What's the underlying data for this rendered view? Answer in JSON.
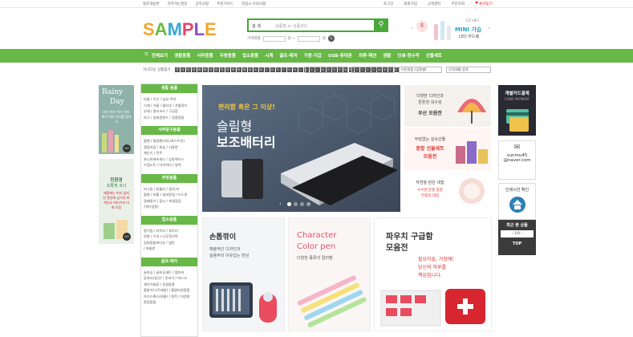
{
  "topbar": {
    "left": [
      "질문과답변",
      "자주하는질문",
      "공지사항",
      "주문가이드",
      "작업시 유의사항"
    ],
    "right": [
      "로그인",
      "회원가입",
      "고객센터",
      "주문조회",
      "즐겨찾기"
    ]
  },
  "logo": {
    "letters": [
      "S",
      "A",
      "M",
      "P",
      "L",
      "E"
    ],
    "colors": [
      "#f2a62c",
      "#6cba3f",
      "#3aa8d8",
      "#e8456b",
      "#8a4fc0",
      "#f2a62c"
    ]
  },
  "search": {
    "category": "검 색",
    "placeholder": "상품명 or 상품코드"
  },
  "price_search": {
    "label": "가격대별",
    "sep1": "원 ~",
    "sep2": "원",
    "go": "G"
  },
  "mini_banner": {
    "line1": "EZ-HIFI",
    "line2": "MINI 가습",
    "line3": "LED 무드램",
    "thumb": "추"
  },
  "nav": {
    "menu_icon": "hamburger-icon",
    "items": [
      "전체보기",
      "생활용품",
      "사무용품",
      "주방용품",
      "업소용품",
      "시계",
      "골프·레저",
      "가방·지갑",
      "USB·휴대폰",
      "의류·패션",
      "생활",
      "인쇄·현수막",
      "선물세트"
    ]
  },
  "alpha_search": {
    "label": "가나다순 상품찾기",
    "keys": [
      "가",
      "나",
      "다",
      "라",
      "마",
      "바",
      "사",
      "아",
      "자",
      "차",
      "카",
      "타",
      "파",
      "하",
      "A",
      "B",
      "C",
      "D",
      "E",
      "F",
      "G",
      "H",
      "I",
      "J",
      "K",
      "L",
      "M",
      "N",
      "O",
      "P",
      "Q",
      "R",
      "S",
      "T",
      "U",
      "V",
      "W",
      "X",
      "Y",
      "Z"
    ]
  },
  "selects": [
    "어린별로 (빨사행)",
    "(자) 분개 (대상별)",
    "어린얼품 (업종별)",
    "가격대별 검색"
  ],
  "left_banners": {
    "rainy_title_1": "Rainy",
    "rainy_title_2": "Day",
    "rainy_text": "여기 여기 미리 준비 해서 여러 미리를 맞아서",
    "go": "GO",
    "eco_title": "친환경",
    "eco_sub": "초록개 코너",
    "eco_text": "제품에는 미리 없지만 환경에 남기지 퍼 계신요 여러가지 미화 모음"
  },
  "categories": [
    {
      "title": "생활 용품",
      "items": [
        "타올 / 우산 / 담요·쿠션",
        "시계 / 거울 / 물티슈 / 손톱깎이",
        "부채 / 멀티코드 / 구급함",
        "머그 / 일회용밴드 / 정품용품"
      ]
    },
    {
      "title": "사무문구용품",
      "items": [
        "볼펜 / 형광펜(지도/포스트잇)",
        "명함지갑 / 회일 / 사용한",
        "계산기 / 전주",
        "포니미에프세드 / 상장케이스",
        "수첩노트 / 다이어리 / 달력"
      ]
    },
    {
      "title": "주방용품",
      "items": [
        "머그컵 / 텀블러 / 컵/도자",
        "물병 / 보틀 / 냄비받침 / 티스푼",
        "밀폐용기 / 접시 / 위생장갑",
        "기타(일용)"
      ]
    },
    {
      "title": "업소용품",
      "items": [
        "종이컵 / 라이터 / 포트리",
        "연봉 / 우지 / 나무젓가락",
        "일회용물퍼티슈 / 냅킨",
        "/ 머슬판"
      ]
    },
    {
      "title": "골프·레저",
      "items": [
        "골프공 / 골프공세트 / 볼마커",
        "등자티(등산) / 민보기 / 마스크",
        "체가거재료 / 등원용품",
        "출발기(스트레칭) / 출발타원용품",
        "아이스팩스(여름) / 원학 / 차량용",
        "창립용품"
      ]
    }
  ],
  "main_banner": {
    "sub": "편리함 혹은 그 이상!",
    "title1": "슬림형",
    "title2": "보조배터리",
    "prev": "‹",
    "next": "›"
  },
  "right_banners": [
    {
      "line1": "다양한 디자인과",
      "line2": "튼튼한 내구성",
      "title": "우산 모음전",
      "title_color": "#333"
    },
    {
      "line1": "부담없는 실속선물",
      "line2": "종합 선물세트",
      "title": "모음전",
      "title_color": "#d33"
    },
    {
      "line1": "자연을 담은 대접",
      "line2": "수수한 분홍 빛깔",
      "title": "컨셉지 대접",
      "title_color": "#d33"
    }
  ],
  "bottom_banners": [
    {
      "title": "손톱깎이",
      "line1": "예술적인 디자인과",
      "line2": "실용주의 이유있는 만남"
    },
    {
      "title1": "Character",
      "title2": "Color pen",
      "line1": "다양한 종류의 컬러펜"
    },
    {
      "title1": "파우치 구급함",
      "title2": "모음전",
      "line1": "필요하죠, 가정에!",
      "line2": "당신의 하루를",
      "line3": "책임집니다."
    }
  ],
  "right_column": {
    "card_title": "개별카드결제",
    "card_sub": "CARD PAYMENT",
    "mail_id": "sunmu45",
    "mail_domain": "@naver.com",
    "print_title": "인쇄시안 확인",
    "recent_title": "최근 본 상품",
    "recent_page": "1/0",
    "top": "TOP"
  },
  "colors": {
    "green": "#67b846",
    "green_dark": "#4aa73a"
  }
}
